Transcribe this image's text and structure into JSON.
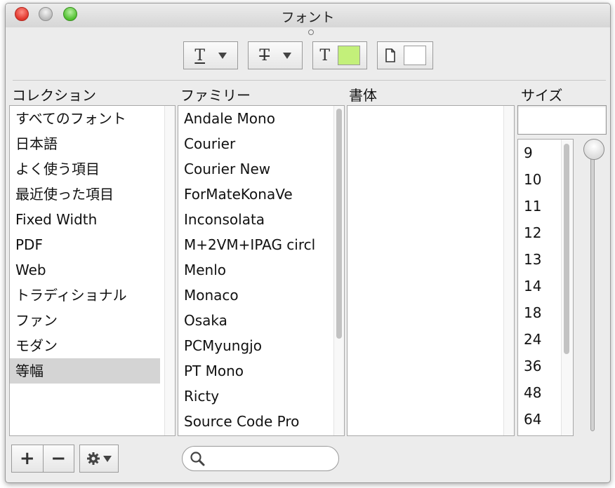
{
  "window": {
    "title": "フォント"
  },
  "toolbar": {
    "underline_icon": "underline-T-icon",
    "strike_icon": "strikethrough-T-icon",
    "text_color_icon": "text-color-T-icon",
    "text_color": "#c3f07a",
    "doc_color_icon": "document-color-icon",
    "doc_color": "#ffffff"
  },
  "collections": {
    "header": "コレクション",
    "items": [
      "すべてのフォント",
      "日本語",
      "よく使う項目",
      "最近使った項目",
      "Fixed Width",
      "PDF",
      "Web",
      "トラディショナル",
      "ファン",
      "モダン",
      "等幅"
    ],
    "selected": "等幅"
  },
  "family": {
    "header": "ファミリー",
    "items": [
      "Andale Mono",
      "Courier",
      "Courier New",
      "ForMateKonaVe",
      "Inconsolata",
      "M+2VM+IPAG circl",
      "Menlo",
      "Monaco",
      "Osaka",
      "PCMyungjo",
      "PT Mono",
      "Ricty",
      "Source Code Pro"
    ]
  },
  "typeface": {
    "header": "書体",
    "items": []
  },
  "size": {
    "header": "サイズ",
    "value": "",
    "items": [
      "9",
      "10",
      "11",
      "12",
      "13",
      "14",
      "18",
      "24",
      "36",
      "48",
      "64"
    ]
  },
  "bottom": {
    "add_icon": "plus-icon",
    "remove_icon": "minus-icon",
    "action_icon": "gear-icon",
    "search_placeholder": ""
  }
}
